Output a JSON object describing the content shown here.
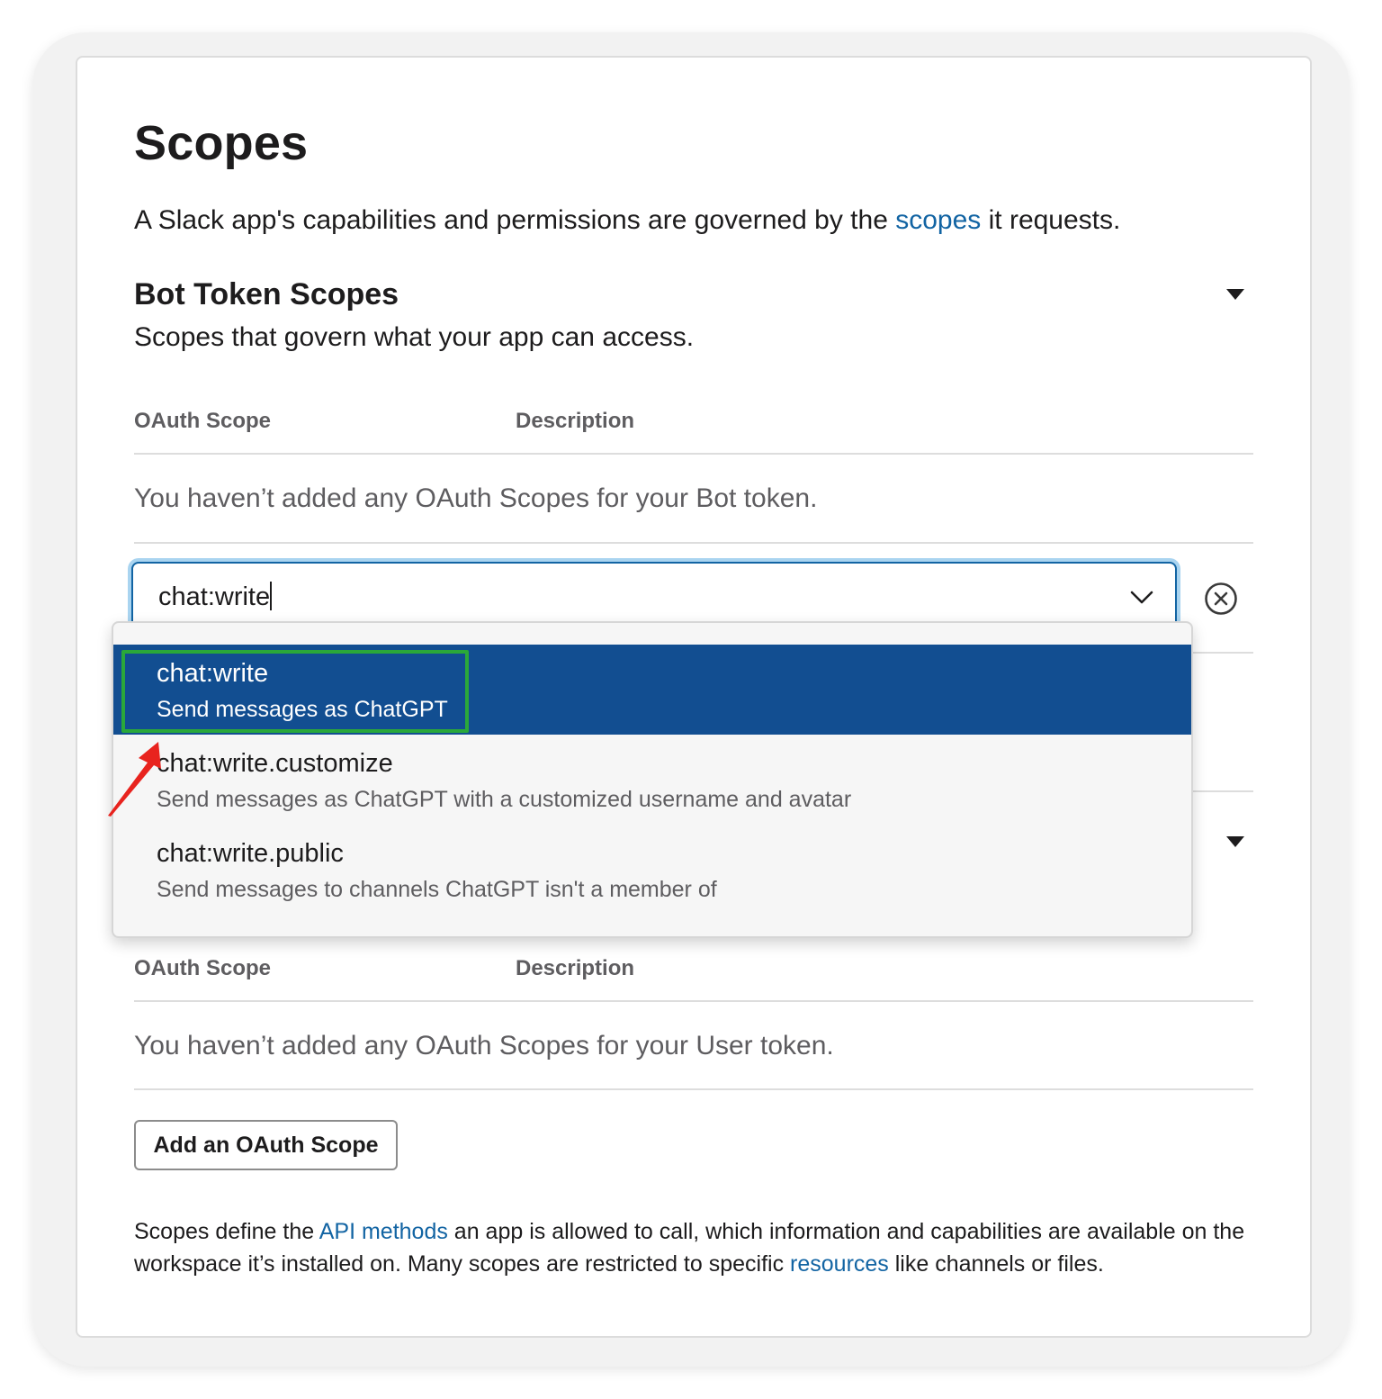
{
  "page": {
    "title": "Scopes",
    "intro_prefix": "A Slack app's capabilities and permissions are governed by the ",
    "intro_link": "scopes",
    "intro_suffix": " it requests."
  },
  "bot_section": {
    "title": "Bot Token Scopes",
    "subtitle": "Scopes that govern what your app can access.",
    "col_scope": "OAuth Scope",
    "col_desc": "Description",
    "empty_text": "You haven’t added any OAuth Scopes for your Bot token."
  },
  "scope_input": {
    "value": "chat:write"
  },
  "dropdown": {
    "options": [
      {
        "title": "chat:write",
        "desc": "Send messages as ChatGPT",
        "selected": true
      },
      {
        "title": "chat:write.customize",
        "desc": "Send messages as ChatGPT with a customized username and avatar",
        "selected": false
      },
      {
        "title": "chat:write.public",
        "desc": "Send messages to channels ChatGPT isn't a member of",
        "selected": false
      }
    ]
  },
  "user_section": {
    "col_scope": "OAuth Scope",
    "col_desc": "Description",
    "empty_text": "You haven’t added any OAuth Scopes for your User token.",
    "add_button": "Add an OAuth Scope"
  },
  "footer": {
    "t1": "Scopes define the ",
    "link1": "API methods",
    "t2": " an app is allowed to call, which information and capabilities are available on the workspace it’s installed on. Many scopes are restricted to specific ",
    "link2": "resources",
    "t3": " like channels or files."
  },
  "colors": {
    "link": "#1264a3",
    "selected_option_bg": "#124e91",
    "annotation_box": "#2aa83a",
    "annotation_arrow": "#e8231e"
  },
  "icons": [
    "chevron-down-icon",
    "clear-circle-x-icon",
    "collapse-caret-icon",
    "annotation-arrow-icon"
  ]
}
